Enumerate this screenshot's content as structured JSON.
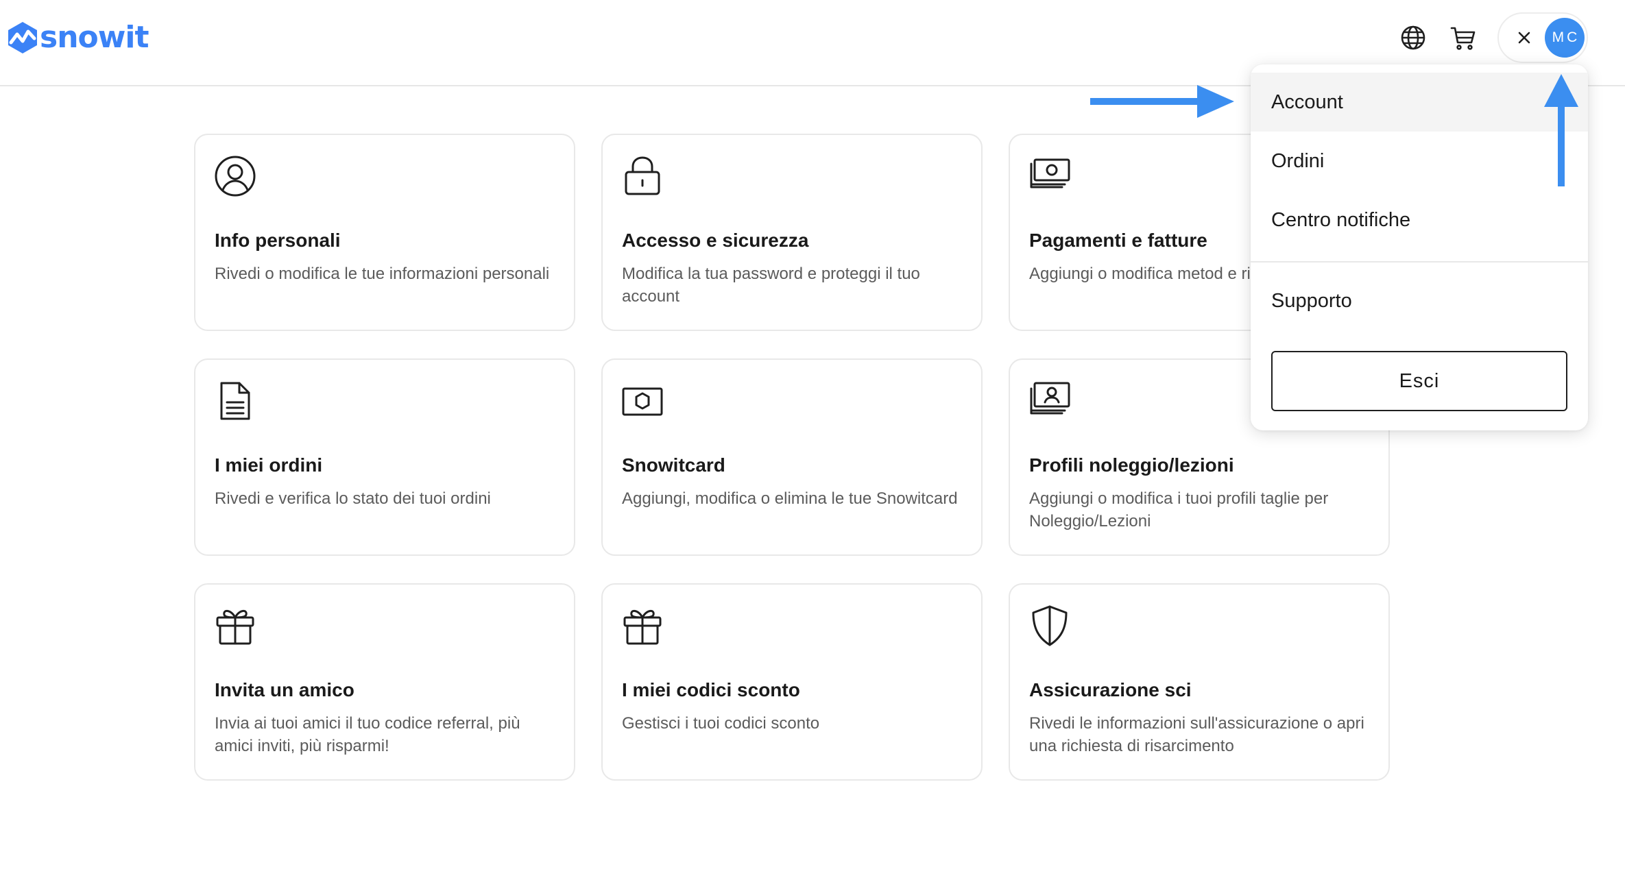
{
  "header": {
    "logo_text": "snowit",
    "language_icon": "globe-icon",
    "cart_icon": "cart-icon",
    "close_icon": "close-icon",
    "avatar_initials": "MC"
  },
  "cards": [
    {
      "icon": "user-circle-icon",
      "title": "Info personali",
      "description": "Rivedi o modifica le tue informazioni personali"
    },
    {
      "icon": "lock-icon",
      "title": "Accesso e sicurezza",
      "description": "Modifica la tua password e proteggi il tuo account"
    },
    {
      "icon": "money-icon",
      "title": "Pagamenti e fatture",
      "description": "Aggiungi o modifica metod e rivedi fatture"
    },
    {
      "icon": "document-icon",
      "title": "I miei ordini",
      "description": "Rivedi e verifica lo stato dei tuoi ordini"
    },
    {
      "icon": "snowitcard-icon",
      "title": "Snowitcard",
      "description": "Aggiungi, modifica o elimina le tue Snowitcard"
    },
    {
      "icon": "profile-card-icon",
      "title": "Profili noleggio/lezioni",
      "description": "Aggiungi o modifica i tuoi profili taglie per Noleggio/Lezioni"
    },
    {
      "icon": "gift-icon",
      "title": "Invita un amico",
      "description": "Invia ai tuoi amici il tuo codice referral, più amici inviti, più risparmi!"
    },
    {
      "icon": "gift-icon",
      "title": "I miei codici sconto",
      "description": "Gestisci i tuoi codici sconto"
    },
    {
      "icon": "shield-icon",
      "title": "Assicurazione sci",
      "description": "Rivedi le informazioni sull'assicurazione o apri una richiesta di risarcimento"
    }
  ],
  "dropdown": {
    "items": [
      {
        "label": "Account",
        "active": true
      },
      {
        "label": "Ordini"
      },
      {
        "label": "Centro notifiche"
      },
      {
        "label": "Supporto"
      }
    ],
    "logout_label": "Esci"
  },
  "colors": {
    "brand": "#3b82f6",
    "avatar": "#3b8ef0",
    "annotation_arrow": "#3b8ef0",
    "active_menu_bg": "#f4f4f4"
  }
}
